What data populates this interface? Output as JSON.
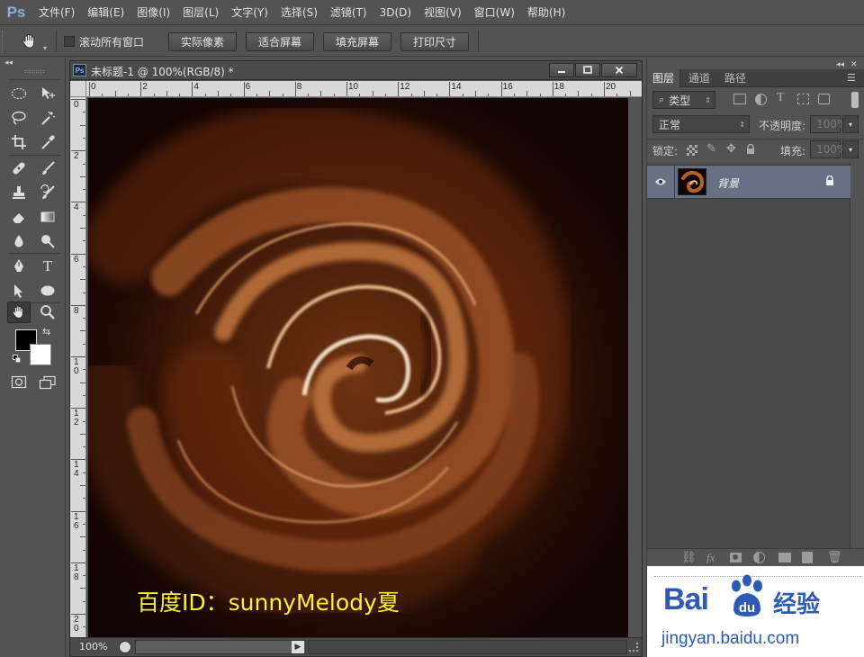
{
  "app": {
    "logo": "Ps"
  },
  "menu": [
    "文件(F)",
    "编辑(E)",
    "图像(I)",
    "图层(L)",
    "文字(Y)",
    "选择(S)",
    "滤镜(T)",
    "3D(D)",
    "视图(V)",
    "窗口(W)",
    "帮助(H)"
  ],
  "options": {
    "tool_icon": "hand-icon",
    "scroll_all_label": "滚动所有窗口",
    "buttons": [
      "实际像素",
      "适合屏幕",
      "填充屏幕",
      "打印尺寸"
    ]
  },
  "document": {
    "badge": "Ps",
    "title": "未标题-1 @ 100%(RGB/8) *",
    "hruler_labels": [
      "0",
      "2",
      "4",
      "6",
      "8",
      "10",
      "12",
      "14",
      "16",
      "18",
      "20"
    ],
    "vruler_labels": [
      "0",
      "2",
      "4",
      "6",
      "8",
      "1\n0",
      "1\n2",
      "1\n4",
      "1\n6",
      "1\n8",
      "2\n0"
    ],
    "zoom": "100%",
    "watermark": "百度ID：sunnyMelody夏"
  },
  "panel": {
    "tabs": [
      "图层",
      "通道",
      "路径"
    ],
    "filter_label": "类型",
    "blend_mode": "正常",
    "opacity_label": "不透明度:",
    "opacity_value": "100%",
    "lock_label": "锁定:",
    "fill_label": "填充:",
    "fill_value": "100%",
    "layer_name": "背景"
  },
  "colors": {
    "ui_bg": "#535353",
    "selected_layer": "#687183",
    "watermark": "#ffef3a",
    "baidu_blue": "#2d5ab7"
  },
  "baidu": {
    "logo_text": "Bai",
    "logo_tail": "经验",
    "url": "jingyan.baidu.com"
  }
}
